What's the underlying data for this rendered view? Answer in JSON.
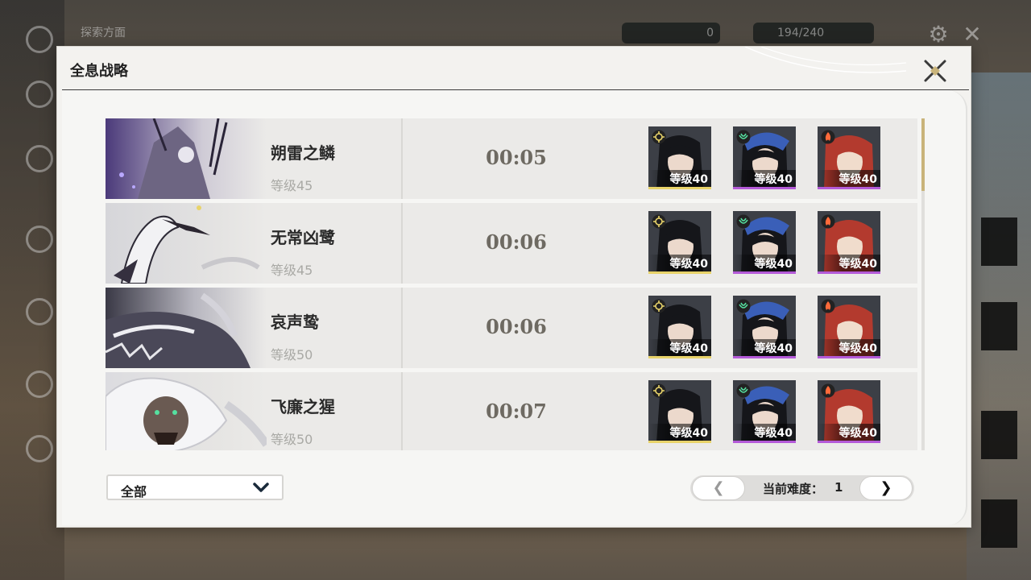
{
  "background_hud": {
    "top_left_label": "探索方面",
    "currency_1": "0",
    "currency_2": "194/240"
  },
  "dialog": {
    "title": "全息战略"
  },
  "rows": [
    {
      "boss_name": "朔雷之鳞",
      "boss_level": "等级45",
      "clear_time": "00:05",
      "team": [
        {
          "level": "等级40",
          "element_icon": "spectro-icon",
          "bar_color": "#e8d36a"
        },
        {
          "level": "等级40",
          "element_icon": "aero-icon",
          "bar_color": "#b45ad8"
        },
        {
          "level": "等级40",
          "element_icon": "fusion-icon",
          "bar_color": "#b45ad8"
        }
      ]
    },
    {
      "boss_name": "无常凶鹭",
      "boss_level": "等级45",
      "clear_time": "00:06",
      "team": [
        {
          "level": "等级40",
          "element_icon": "spectro-icon",
          "bar_color": "#e8d36a"
        },
        {
          "level": "等级40",
          "element_icon": "aero-icon",
          "bar_color": "#b45ad8"
        },
        {
          "level": "等级40",
          "element_icon": "fusion-icon",
          "bar_color": "#b45ad8"
        }
      ]
    },
    {
      "boss_name": "哀声鸷",
      "boss_level": "等级50",
      "clear_time": "00:06",
      "team": [
        {
          "level": "等级40",
          "element_icon": "spectro-icon",
          "bar_color": "#e8d36a"
        },
        {
          "level": "等级40",
          "element_icon": "aero-icon",
          "bar_color": "#b45ad8"
        },
        {
          "level": "等级40",
          "element_icon": "fusion-icon",
          "bar_color": "#b45ad8"
        }
      ]
    },
    {
      "boss_name": "飞廉之猩",
      "boss_level": "等级50",
      "clear_time": "00:07",
      "team": [
        {
          "level": "等级40",
          "element_icon": "spectro-icon",
          "bar_color": "#e8d36a"
        },
        {
          "level": "等级40",
          "element_icon": "aero-icon",
          "bar_color": "#b45ad8"
        },
        {
          "level": "等级40",
          "element_icon": "fusion-icon",
          "bar_color": "#b45ad8"
        }
      ]
    }
  ],
  "filter": {
    "selected": "全部"
  },
  "pager": {
    "prev_glyph": "❮",
    "next_glyph": "❯",
    "label": "当前难度：",
    "difficulty": "1"
  },
  "colors": {
    "accent_gold": "#c9b47a",
    "panel": "#f3f2ef",
    "row_bg": "#ebeae8"
  }
}
